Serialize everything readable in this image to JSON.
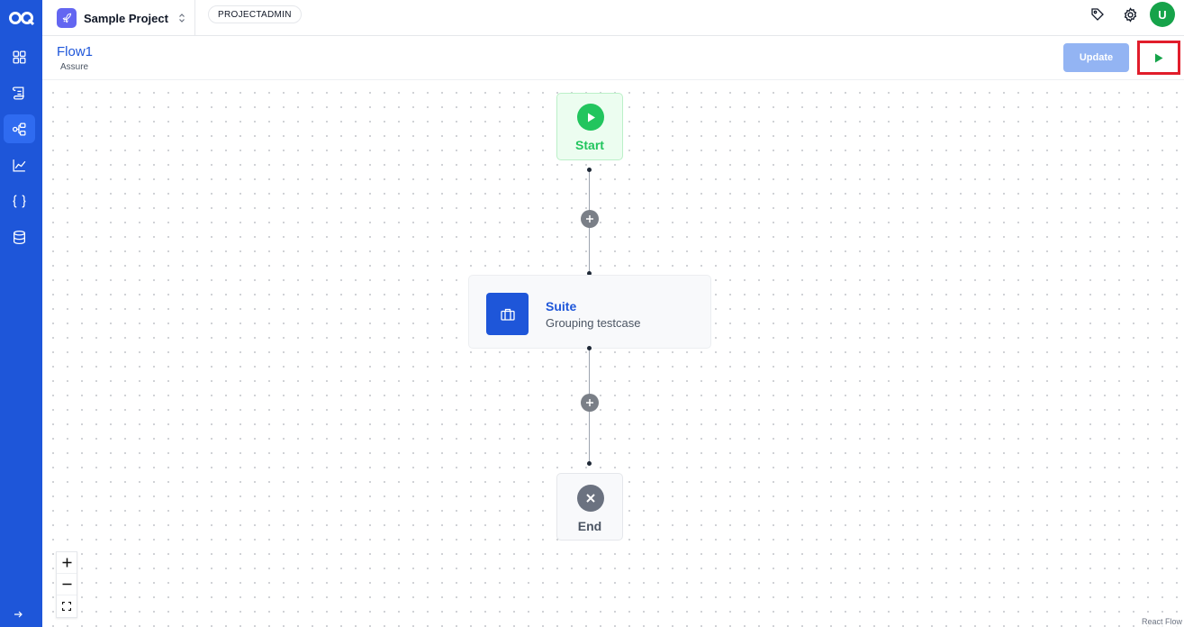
{
  "sidebar": {
    "logo": "oq-logo-icon",
    "items": [
      {
        "icon": "dashboard-grid-icon",
        "active": false
      },
      {
        "icon": "testcases-scroll-icon",
        "active": false
      },
      {
        "icon": "flows-icon",
        "active": true
      },
      {
        "icon": "reports-chart-icon",
        "active": false
      },
      {
        "icon": "variables-braces-icon",
        "active": false
      },
      {
        "icon": "database-icon",
        "active": false
      }
    ],
    "expand_icon": "arrow-right-icon"
  },
  "topbar": {
    "project_name": "Sample Project",
    "role": "PROJECTADMIN",
    "avatar_initial": "U"
  },
  "subheader": {
    "title": "Flow1",
    "subtitle": "Assure",
    "update_label": "Update"
  },
  "flow": {
    "start_label": "Start",
    "suite_title": "Suite",
    "suite_subtitle": "Grouping testcase",
    "end_label": "End"
  },
  "canvas": {
    "attribution": "React Flow"
  },
  "colors": {
    "sidebar": "#1e56d9",
    "accent": "#1e56d9",
    "start": "#22c55e",
    "end": "#6b7280",
    "run": "#16a34a",
    "highlight": "#e11d2b"
  }
}
